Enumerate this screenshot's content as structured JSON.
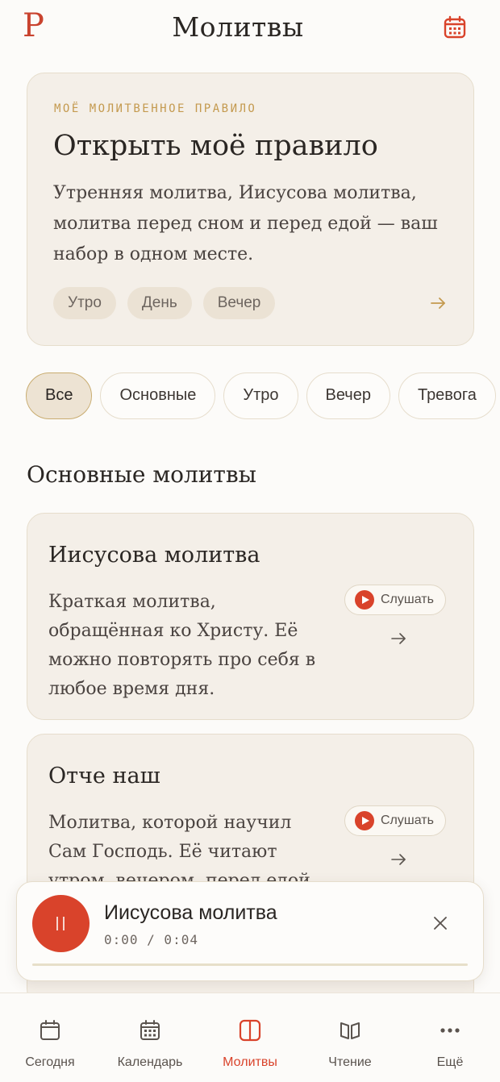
{
  "header": {
    "logo_glyph": "Р",
    "title": "Молитвы",
    "calendar_icon": "calendar-icon"
  },
  "rule_card": {
    "eyebrow": "МОЁ МОЛИТВЕННОЕ ПРАВИЛО",
    "title": "Открыть моё правило",
    "description": "Утренняя молитва, Иисусова молитва, молитва перед сном и перед едой — ваш набор в одном месте.",
    "chips": [
      "Утро",
      "День",
      "Вечер"
    ],
    "arrow_icon": "arrow-right-icon"
  },
  "filters": {
    "items": [
      "Все",
      "Основные",
      "Утро",
      "Вечер",
      "Тревога"
    ],
    "active": "Все"
  },
  "section": {
    "title": "Основные молитвы"
  },
  "prayers": [
    {
      "title": "Иисусова молитва",
      "description": "Краткая молитва, обращённая ко Христу. Её можно повторять про себя в любое время дня.",
      "listen_label": "Слушать"
    },
    {
      "title": "Отче наш",
      "description": "Молитва, которой научил Сам Господь. Её читают утром, вечером, перед едой.",
      "listen_label": "Слушать"
    }
  ],
  "player": {
    "title": "Иисусова молитва",
    "time": "0:00 / 0:04",
    "progress_fraction": 0.0,
    "pause_icon": "pause-icon",
    "close_icon": "close-icon"
  },
  "tabbar": {
    "items": [
      {
        "label": "Сегодня",
        "icon": "calendar-day-icon"
      },
      {
        "label": "Календарь",
        "icon": "calendar-grid-icon"
      },
      {
        "label": "Молитвы",
        "icon": "panels-icon"
      },
      {
        "label": "Чтение",
        "icon": "book-icon"
      },
      {
        "label": "Ещё",
        "icon": "more-icon"
      }
    ],
    "active": "Молитвы"
  },
  "colors": {
    "accent": "#d9432b",
    "gold": "#c49a4f",
    "card_bg": "#f4efe8",
    "page_bg": "#fcfbf9"
  }
}
